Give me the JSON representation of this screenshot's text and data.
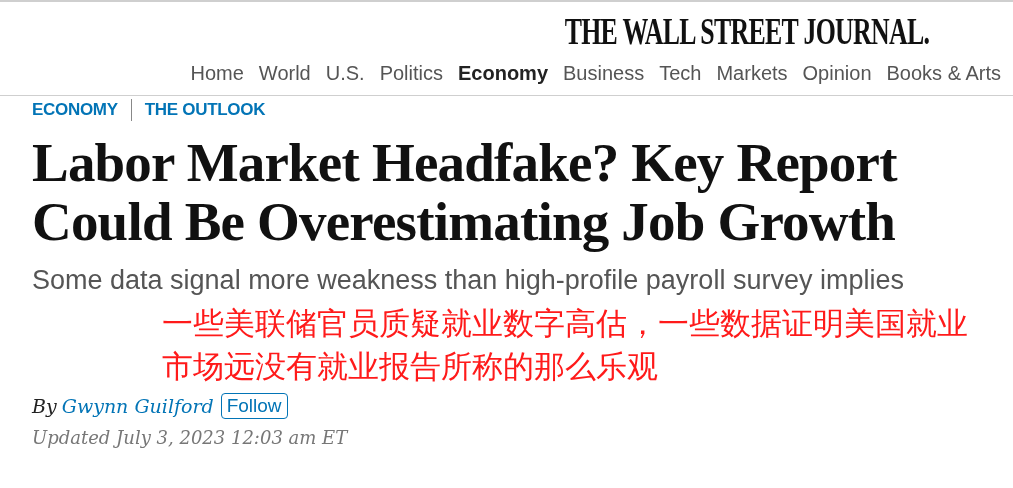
{
  "masthead": "THE WALL STREET JOURNAL.",
  "nav": [
    {
      "label": "Home",
      "selected": false
    },
    {
      "label": "World",
      "selected": false
    },
    {
      "label": "U.S.",
      "selected": false
    },
    {
      "label": "Politics",
      "selected": false
    },
    {
      "label": "Economy",
      "selected": true
    },
    {
      "label": "Business",
      "selected": false
    },
    {
      "label": "Tech",
      "selected": false
    },
    {
      "label": "Markets",
      "selected": false
    },
    {
      "label": "Opinion",
      "selected": false
    },
    {
      "label": "Books & Arts",
      "selected": false
    }
  ],
  "categories": [
    "ECONOMY",
    "THE OUTLOOK"
  ],
  "headline": "Labor Market Headfake? Key Report Could Be Overestimating Job Growth",
  "subtitle": "Some data signal more weakness than high-profile payroll survey implies",
  "annotation": "一些美联储官员质疑就业数字高估，一些数据证明美国就业市场远没有就业报告所称的那么乐观",
  "byline": {
    "prefix": "By",
    "author": "Gwynn Guilford",
    "follow_button": "Follow"
  },
  "updated": "Updated July 3, 2023 12:03 am ET"
}
